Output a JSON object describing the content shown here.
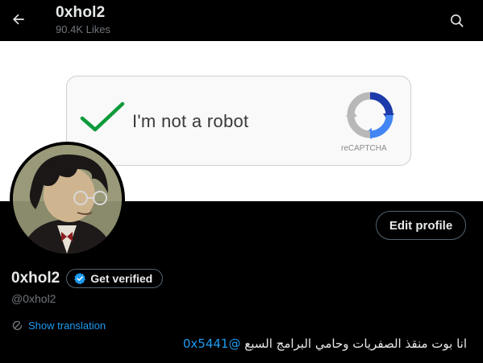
{
  "header": {
    "title": "0xhol2",
    "likes": "90.4K Likes"
  },
  "banner": {
    "captcha_text": "I'm not a robot",
    "captcha_brand": "reCAPTCHA"
  },
  "profile": {
    "display_name": "0xhol2",
    "verify_label": "Get verified",
    "handle": "@0xhol2",
    "edit_label": "Edit profile",
    "translate_label": "Show translation",
    "bio_text": "انا بوت منقذ الصفريات وحامي البرامج السبع",
    "bio_mention": "@0x5441"
  },
  "colors": {
    "accent": "#1d9bf0",
    "background": "#000000",
    "muted": "#71767b",
    "check_green": "#0d9a3a"
  },
  "icons": [
    "back-arrow-icon",
    "search-icon",
    "checkmark-icon",
    "recaptcha-logo-icon",
    "verified-badge-icon",
    "translate-icon"
  ]
}
